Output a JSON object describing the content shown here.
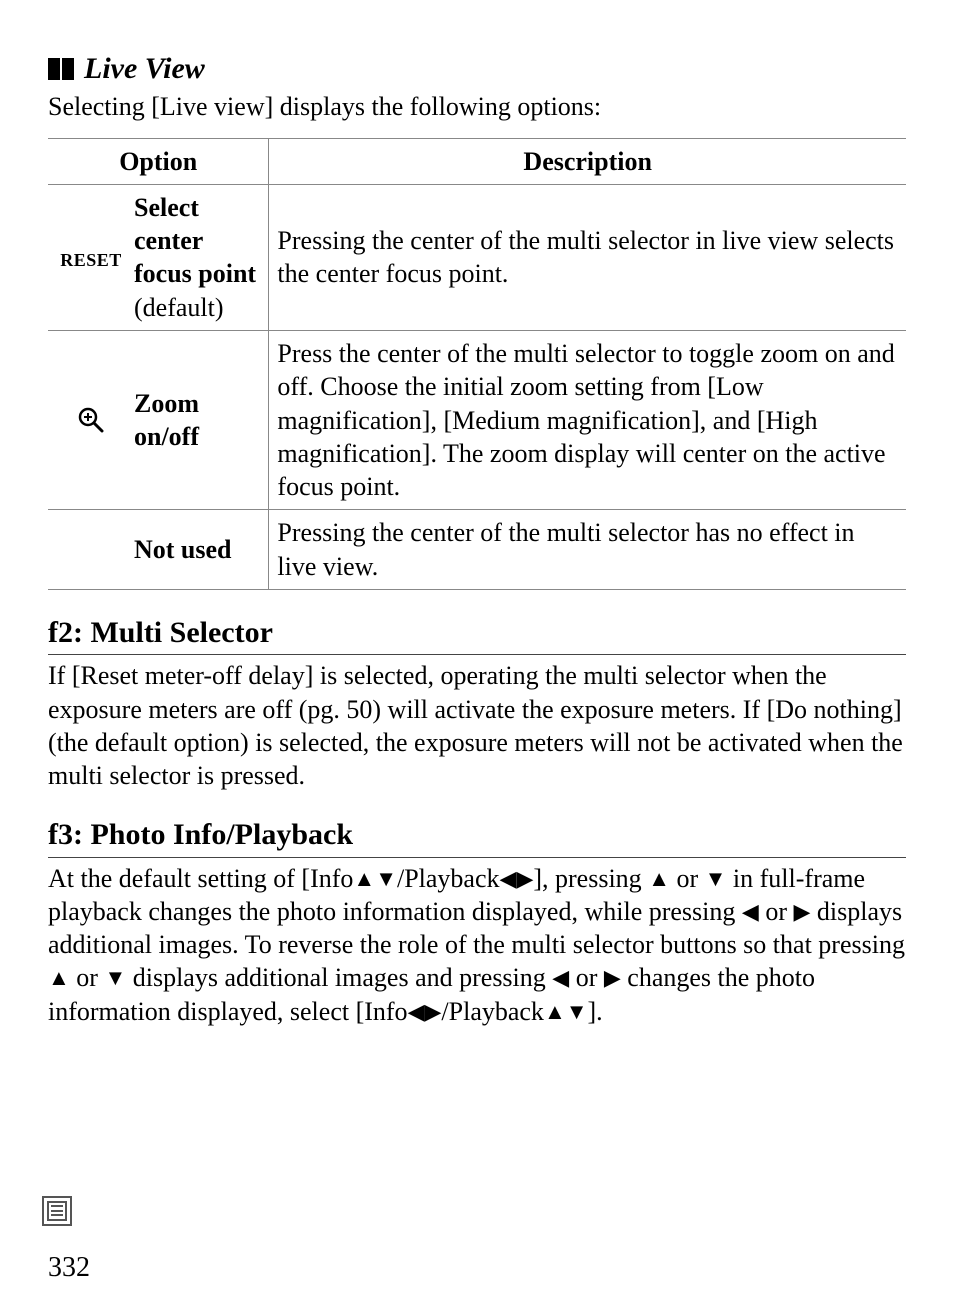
{
  "liveview": {
    "heading": "Live View",
    "intro": "Selecting [Live view] displays the following options:",
    "th_option": "Option",
    "th_desc": "Description",
    "rows": [
      {
        "icon_text": "RESET",
        "label_main": "Select center focus point",
        "label_sub": "(default)",
        "desc": "Pressing the center of the multi selector in live view selects the center focus point."
      },
      {
        "icon_text": "",
        "label_main": "Zoom on/off",
        "label_sub": "",
        "desc": "Press the center of the multi selector to toggle zoom on and off.  Choose the initial zoom setting from [Low magnification], [Medium magnification], and [High magnification]. The zoom display will center on the active focus point."
      },
      {
        "icon_text": "",
        "label_main": "Not used",
        "label_sub": "",
        "desc": "Pressing the center of the multi selector has no effect in live view."
      }
    ]
  },
  "f2": {
    "title": "f2: Multi Selector",
    "body": "If [Reset meter-off delay] is selected, operating the multi selector when the exposure meters are off (pg. 50) will activate the exposure meters.  If [Do nothing] (the default option) is selected, the exposure meters will not be activated when the multi selector is pressed."
  },
  "f3": {
    "title": "f3: Photo Info/Playback",
    "body_parts": {
      "a": "At the default setting of [Info",
      "b": "/Playback",
      "c": "], pressing ",
      "d": " or ",
      "e": " in full-frame playback changes the photo information displayed, while pressing ",
      "f": " or ",
      "g": " displays additional images.  To reverse the role of the multi selector buttons so that pressing ",
      "h": " or ",
      "i": " displays additional images and pressing ",
      "j": " or ",
      "k": " changes the photo information displayed, select [Info",
      "l": "/Playback",
      "m": "]."
    }
  },
  "glyphs": {
    "up": "▲",
    "down": "▼",
    "left": "◀",
    "right": "▶"
  },
  "page_number": "332"
}
